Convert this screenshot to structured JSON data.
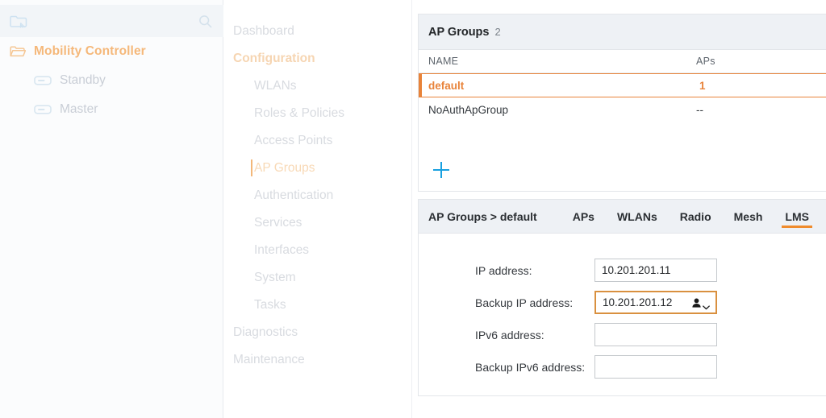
{
  "sidebar": {
    "search": {
      "placeholder": "",
      "value": "",
      "folder_icon": "folder-cursor-icon",
      "search_icon": "search-icon"
    },
    "tree": {
      "root": {
        "label": "Mobility Controller",
        "icon": "folder-open-icon"
      },
      "children": [
        {
          "label": "Standby",
          "icon": "controller-icon"
        },
        {
          "label": "Master",
          "icon": "controller-icon"
        }
      ]
    }
  },
  "nav": {
    "items": [
      {
        "label": "Dashboard",
        "level": 1,
        "active": false,
        "section": false
      },
      {
        "label": "Configuration",
        "level": 1,
        "active": false,
        "section": true
      },
      {
        "label": "WLANs",
        "level": 2,
        "active": false,
        "section": false
      },
      {
        "label": "Roles & Policies",
        "level": 2,
        "active": false,
        "section": false
      },
      {
        "label": "Access Points",
        "level": 2,
        "active": false,
        "section": false
      },
      {
        "label": "AP Groups",
        "level": 2,
        "active": true,
        "section": false
      },
      {
        "label": "Authentication",
        "level": 2,
        "active": false,
        "section": false
      },
      {
        "label": "Services",
        "level": 2,
        "active": false,
        "section": false
      },
      {
        "label": "Interfaces",
        "level": 2,
        "active": false,
        "section": false
      },
      {
        "label": "System",
        "level": 2,
        "active": false,
        "section": false
      },
      {
        "label": "Tasks",
        "level": 2,
        "active": false,
        "section": false
      },
      {
        "label": "Diagnostics",
        "level": 1,
        "active": false,
        "section": false
      },
      {
        "label": "Maintenance",
        "level": 1,
        "active": false,
        "section": false
      }
    ]
  },
  "ap_groups_panel": {
    "title": "AP Groups",
    "count": "2",
    "columns": {
      "name": "NAME",
      "aps": "APs"
    },
    "rows": [
      {
        "name": "default",
        "aps": "1",
        "selected": true
      },
      {
        "name": "NoAuthApGroup",
        "aps": "--",
        "selected": false
      }
    ],
    "add_button": {
      "icon": "plus-icon",
      "label": ""
    }
  },
  "detail_panel": {
    "breadcrumb": "AP Groups > default",
    "tabs": [
      {
        "label": "APs",
        "active": false
      },
      {
        "label": "WLANs",
        "active": false
      },
      {
        "label": "Radio",
        "active": false
      },
      {
        "label": "Mesh",
        "active": false
      },
      {
        "label": "LMS",
        "active": true
      }
    ],
    "fields": [
      {
        "label": "IP address:",
        "value": "10.201.201.11",
        "focused": false,
        "autofill": false
      },
      {
        "label": "Backup IP address:",
        "value": "10.201.201.12",
        "focused": true,
        "autofill": true
      },
      {
        "label": "IPv6 address:",
        "value": "",
        "focused": false,
        "autofill": false
      },
      {
        "label": "Backup IPv6 address:",
        "value": "",
        "focused": false,
        "autofill": false
      }
    ]
  },
  "colors": {
    "accent_orange": "#e8833a",
    "tab_underline": "#ef8b2c",
    "add_blue": "#18a0e0",
    "panel_header_bg": "#eef1f5",
    "focus_border": "#d9903f"
  }
}
